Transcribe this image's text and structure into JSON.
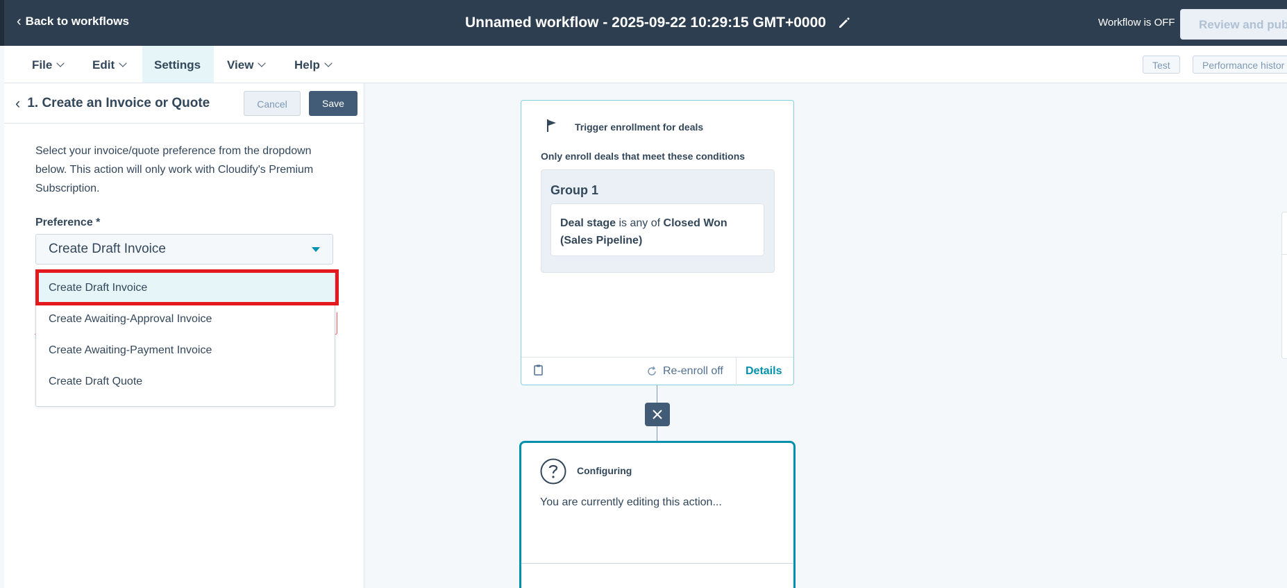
{
  "header": {
    "back_label": "Back to workflows",
    "workflow_title": "Unnamed workflow - 2025-09-22 10:29:15 GMT+0000",
    "status": "Workflow is OFF",
    "publish_label": "Review and publi"
  },
  "menu": {
    "file": "File",
    "edit": "Edit",
    "settings": "Settings",
    "view": "View",
    "help": "Help",
    "test": "Test",
    "performance": "Performance histor"
  },
  "sidebar": {
    "title": "1. Create an Invoice or Quote",
    "cancel": "Cancel",
    "save": "Save",
    "description": "Select your invoice/quote preference from the dropdown below. This action will only work with Cloudify's Premium Subscription.",
    "preference_label": "Preference *",
    "selected_value": "Create Draft Invoice",
    "options": [
      "Create Draft Invoice",
      "Create Awaiting-Approval Invoice",
      "Create Awaiting-Payment Invoice",
      "Create Draft Quote"
    ]
  },
  "trigger": {
    "title": "Trigger enrollment for deals",
    "subtitle": "Only enroll deals that meet these conditions",
    "group": "Group 1",
    "condition": {
      "property": "Deal stage",
      "operator": " is any of ",
      "value": "Closed Won (Sales Pipeline)"
    },
    "reenroll": "Re-enroll off",
    "details": "Details"
  },
  "action": {
    "title": "Configuring",
    "text": "You are currently editing this action..."
  },
  "colors": {
    "header_bg": "#2d3e50",
    "accent": "#0091ae",
    "save_bg": "#425b76",
    "highlight": "#e3191e"
  }
}
